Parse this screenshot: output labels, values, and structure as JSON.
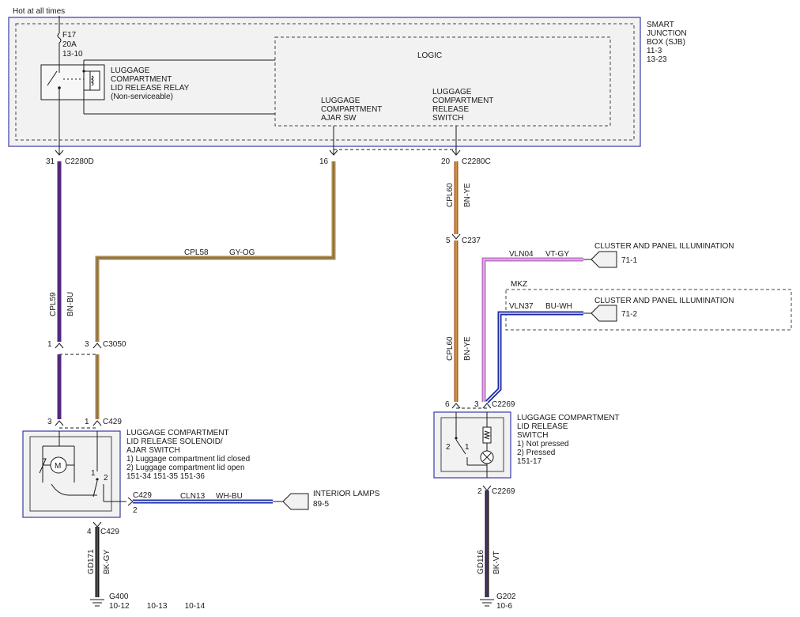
{
  "header": {
    "hot": "Hot at all times"
  },
  "sjb": {
    "name": [
      "SMART",
      "JUNCTION",
      "BOX (SJB)"
    ],
    "refs": [
      "11-3",
      "13-23"
    ],
    "fuse": [
      "F17",
      "20A",
      "13-10"
    ],
    "relay": [
      "LUGGAGE",
      "COMPARTMENT",
      "LID RELEASE RELAY",
      "(Non-serviceable)"
    ],
    "logic": "LOGIC",
    "ajar_sw": [
      "LUGGAGE",
      "COMPARTMENT",
      "AJAR SW"
    ],
    "release_sw": [
      "LUGGAGE",
      "COMPARTMENT",
      "RELEASE",
      "SWITCH"
    ]
  },
  "pins": {
    "c2280d_pin": "31",
    "c2280d": "C2280D",
    "p16": "16",
    "c2280c_pin": "20",
    "c2280c": "C2280C",
    "c237_pin": "5",
    "c237": "C237",
    "c3050_left": "1",
    "c3050_right": "3",
    "c3050": "C3050",
    "c429_left": "3",
    "c429_right": "1",
    "c429": "C429",
    "c2269_left": "6",
    "c2269_right": "3",
    "c2269": "C2269",
    "c429b": "C429",
    "c429b_pin": "2",
    "c429c_pin": "4",
    "c429c": "C429",
    "c2269b_pin": "2",
    "c2269b": "C2269"
  },
  "wires": {
    "cpl59": "CPL59",
    "cpl59_color": "BN-BU",
    "cpl58": "CPL58",
    "cpl58_color": "GY-OG",
    "cpl60a": "CPL60",
    "cpl60a_color": "BN-YE",
    "cpl60b": "CPL60",
    "cpl60b_color": "BN-YE",
    "vln04": "VLN04",
    "vln04_color": "VT-GY",
    "vln37": "VLN37",
    "vln37_color": "BU-WH",
    "cln13": "CLN13",
    "cln13_color": "WH-BU",
    "gd171": "GD171",
    "gd171_color": "BK-GY",
    "gd116": "GD116",
    "gd116_color": "BK-VT"
  },
  "dests": {
    "illum1": "CLUSTER AND PANEL ILLUMINATION",
    "illum1_ref": "71-1",
    "mkz": "MKZ",
    "illum2": "CLUSTER AND PANEL ILLUMINATION",
    "illum2_ref": "71-2",
    "interior": "INTERIOR LAMPS",
    "interior_ref": "89-5"
  },
  "solenoid": {
    "lines": [
      "LUGGAGE COMPARTMENT",
      "LID RELEASE SOLENOID/",
      "AJAR SWITCH",
      "1) Luggage compartment lid closed",
      "2) Luggage compartment lid open",
      "151-34   151-35   151-36"
    ],
    "motor": "M",
    "pos1": "1",
    "pos2": "2"
  },
  "release_switch": {
    "lines": [
      "LUGGAGE COMPARTMENT",
      "LID RELEASE",
      "SWITCH",
      "1) Not pressed",
      "2) Pressed",
      "151-17"
    ],
    "pos1": "1",
    "pos2": "2"
  },
  "grounds": {
    "g400": "G400",
    "g400_refs": "10-12        10-13        10-14",
    "g202": "G202",
    "g202_ref": "10-6"
  },
  "colors": {
    "frame": "#3a3aa8",
    "brown_blue_a": "#5a2a7a",
    "brown_blue_b": "#3a2a9a",
    "gray_orange": "#b08a4a",
    "brown_yellow": "#b0582a",
    "violet_gray": "#c070c8",
    "blue_white": "#1a2aa8",
    "black": "#1a1a1a"
  }
}
